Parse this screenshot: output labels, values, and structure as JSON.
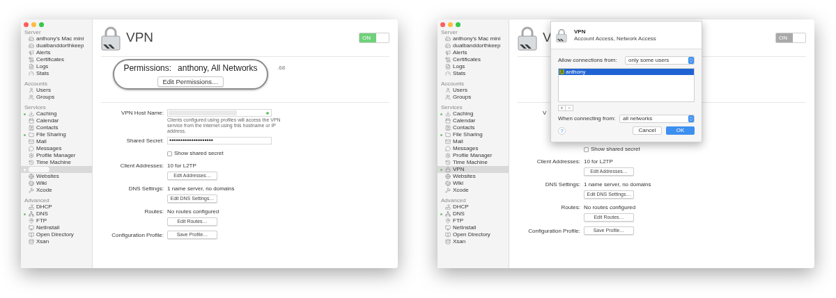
{
  "windows": [
    {
      "sidebar": [
        {
          "title": "Server",
          "items": [
            {
              "label": "anthony's Mac mini",
              "selected": false,
              "running": false
            },
            {
              "label": "dualbanddorthkeep",
              "selected": false,
              "running": false
            },
            {
              "label": "Alerts",
              "selected": false,
              "running": false
            },
            {
              "label": "Certificates",
              "selected": false,
              "running": false
            },
            {
              "label": "Logs",
              "selected": false,
              "running": false
            },
            {
              "label": "Stats",
              "selected": false,
              "running": false
            }
          ]
        },
        {
          "title": "Accounts",
          "items": [
            {
              "label": "Users",
              "selected": false,
              "running": false
            },
            {
              "label": "Groups",
              "selected": false,
              "running": false
            }
          ]
        },
        {
          "title": "Services",
          "items": [
            {
              "label": "Caching",
              "selected": false,
              "running": true
            },
            {
              "label": "Calendar",
              "selected": false,
              "running": false
            },
            {
              "label": "Contacts",
              "selected": false,
              "running": false
            },
            {
              "label": "File Sharing",
              "selected": false,
              "running": true
            },
            {
              "label": "Mail",
              "selected": false,
              "running": false
            },
            {
              "label": "Messages",
              "selected": false,
              "running": false
            },
            {
              "label": "Profile Manager",
              "selected": false,
              "running": false
            },
            {
              "label": "Time Machine",
              "selected": false,
              "running": false
            },
            {
              "selected": true,
              "running": true,
              "obscured": true
            },
            {
              "label": "Websites",
              "selected": false,
              "running": false
            },
            {
              "label": "Wiki",
              "selected": false,
              "running": false
            },
            {
              "label": "Xcode",
              "selected": false,
              "running": false
            }
          ]
        },
        {
          "title": "Advanced",
          "items": [
            {
              "label": "DHCP",
              "selected": false,
              "running": false
            },
            {
              "label": "DNS",
              "selected": false,
              "running": true
            },
            {
              "label": "FTP",
              "selected": false,
              "running": false
            },
            {
              "label": "NetInstall",
              "selected": false,
              "running": false
            },
            {
              "label": "Open Directory",
              "selected": false,
              "running": false
            },
            {
              "label": "Xsan",
              "selected": false,
              "running": false
            }
          ]
        }
      ],
      "main": {
        "title": "VPN",
        "toggle": {
          "label": "ON",
          "on": true,
          "active": true
        },
        "permissions": {
          "label": "Permissions:",
          "value": "anthony, All Networks",
          "button": "Edit Permissions…",
          "side_text": ".68"
        },
        "form": [
          {
            "kind": "host",
            "label": "VPN Host Name:",
            "valid": true,
            "help": "Clients configured using profiles will access the VPN service from the internet using this hostname or IP address."
          },
          {
            "kind": "secret",
            "label": "Shared Secret:",
            "value": "••••••••••••••••••••"
          },
          {
            "kind": "checkbox",
            "label": "Show shared secret",
            "checked": false
          },
          {
            "kind": "value_button",
            "label": "Client Addresses:",
            "value": "10 for L2TP",
            "button": "Edit Addresses…"
          },
          {
            "kind": "value_button",
            "label": "DNS Settings:",
            "value": "1 name server, no domains",
            "button": "Edit DNS Settings…"
          },
          {
            "kind": "value_button",
            "label": "Routes:",
            "value": "No routes configured",
            "button": "Edit Routes…"
          },
          {
            "kind": "button",
            "label": "Configuration Profile:",
            "button": "Save Profile…"
          }
        ]
      }
    },
    {
      "sidebar": [
        {
          "title": "Server",
          "items": [
            {
              "label": "anthony's Mac mini",
              "selected": false,
              "running": false
            },
            {
              "label": "dualbanddorthkeep",
              "selected": false,
              "running": false
            },
            {
              "label": "Alerts",
              "selected": false,
              "running": false
            },
            {
              "label": "Certificates",
              "selected": false,
              "running": false
            },
            {
              "label": "Logs",
              "selected": false,
              "running": false
            },
            {
              "label": "Stats",
              "selected": false,
              "running": false
            }
          ]
        },
        {
          "title": "Accounts",
          "items": [
            {
              "label": "Users",
              "selected": false,
              "running": false
            },
            {
              "label": "Groups",
              "selected": false,
              "running": false
            }
          ]
        },
        {
          "title": "Services",
          "items": [
            {
              "label": "Caching",
              "selected": false,
              "running": true
            },
            {
              "label": "Calendar",
              "selected": false,
              "running": false
            },
            {
              "label": "Contacts",
              "selected": false,
              "running": false
            },
            {
              "label": "File Sharing",
              "selected": false,
              "running": true
            },
            {
              "label": "Mail",
              "selected": false,
              "running": false
            },
            {
              "label": "Messages",
              "selected": false,
              "running": false
            },
            {
              "label": "Profile Manager",
              "selected": false,
              "running": false
            },
            {
              "label": "Time Machine",
              "selected": false,
              "running": false
            },
            {
              "label": "VPN",
              "selected": true,
              "running": true
            },
            {
              "label": "Websites",
              "selected": false,
              "running": false
            },
            {
              "label": "Wiki",
              "selected": false,
              "running": false
            },
            {
              "label": "Xcode",
              "selected": false,
              "running": false
            }
          ]
        },
        {
          "title": "Advanced",
          "items": [
            {
              "label": "DHCP",
              "selected": false,
              "running": false
            },
            {
              "label": "DNS",
              "selected": false,
              "running": true
            },
            {
              "label": "FTP",
              "selected": false,
              "running": false
            },
            {
              "label": "NetInstall",
              "selected": false,
              "running": false
            },
            {
              "label": "Open Directory",
              "selected": false,
              "running": false
            },
            {
              "label": "Xsan",
              "selected": false,
              "running": false
            }
          ]
        }
      ],
      "main": {
        "title": "V",
        "toggle": {
          "label": "ON",
          "on": true,
          "active": false
        },
        "form": [
          {
            "kind": "fragment",
            "label": "V"
          },
          {
            "kind": "checkbox",
            "label": "Show shared secret",
            "checked": false
          },
          {
            "kind": "value_button",
            "label": "Client Addresses:",
            "value": "10 for L2TP",
            "button": "Edit Addresses…"
          },
          {
            "kind": "value_button",
            "label": "DNS Settings:",
            "value": "1 name server, no domains",
            "button": "Edit DNS Settings…"
          },
          {
            "kind": "value_button",
            "label": "Routes:",
            "value": "No routes configured",
            "button": "Edit Routes…"
          },
          {
            "kind": "button",
            "label": "Configuration Profile:",
            "button": "Save Profile…"
          }
        ]
      },
      "dialog": {
        "title": "VPN",
        "subtitle": "Account Access, Network Access",
        "allow_label": "Allow connections from:",
        "allow_value": "only some users",
        "users": [
          {
            "label": "anthony",
            "selected": true
          }
        ],
        "add": "+",
        "remove": "−",
        "network_label": "When connecting from:",
        "network_value": "all networks",
        "help": "?",
        "cancel": "Cancel",
        "ok": "OK"
      }
    }
  ]
}
